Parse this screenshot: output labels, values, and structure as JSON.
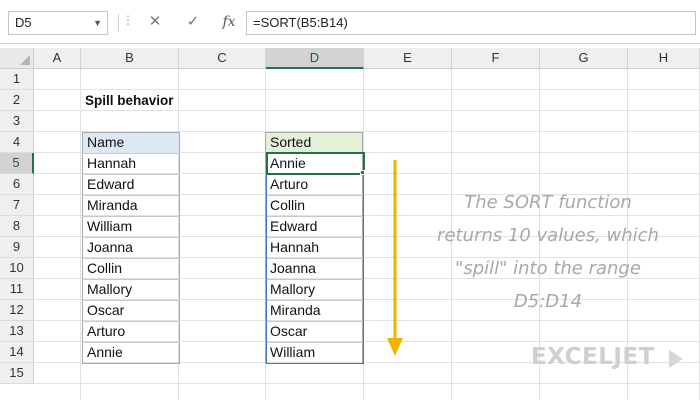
{
  "formula_bar": {
    "name_box": "D5",
    "formula": "=SORT(B5:B14)",
    "cancel_glyph": "✕",
    "confirm_glyph": "✓",
    "fx_label": "fx"
  },
  "columns": [
    "A",
    "B",
    "C",
    "D",
    "E",
    "F",
    "G",
    "H"
  ],
  "rows": [
    "1",
    "2",
    "3",
    "4",
    "5",
    "6",
    "7",
    "8",
    "9",
    "10",
    "11",
    "12",
    "13",
    "14",
    "15"
  ],
  "active_cell": {
    "column": "D",
    "row": "5"
  },
  "sheet": {
    "title": "Spill behavior",
    "name_header": "Name",
    "names": [
      "Hannah",
      "Edward",
      "Miranda",
      "William",
      "Joanna",
      "Collin",
      "Mallory",
      "Oscar",
      "Arturo",
      "Annie"
    ],
    "sorted_header": "Sorted",
    "sorted": [
      "Annie",
      "Arturo",
      "Collin",
      "Edward",
      "Hannah",
      "Joanna",
      "Mallory",
      "Miranda",
      "Oscar",
      "William"
    ]
  },
  "annotation": {
    "lines": [
      "The SORT function",
      "returns 10 values, which",
      "\"spill\" into the range",
      "D5:D14"
    ],
    "color": "#a8a8a8"
  },
  "arrow_color": "#f0b400",
  "logo": {
    "text": "EXCELJET",
    "color": "#cfcfcf",
    "icon": "exceljet-logo-icon"
  },
  "colors": {
    "accent": "#217346",
    "name_header_bg": "#dde8f5",
    "sorted_header_bg": "#e5f0d8",
    "spill_border": "#4472c4"
  }
}
